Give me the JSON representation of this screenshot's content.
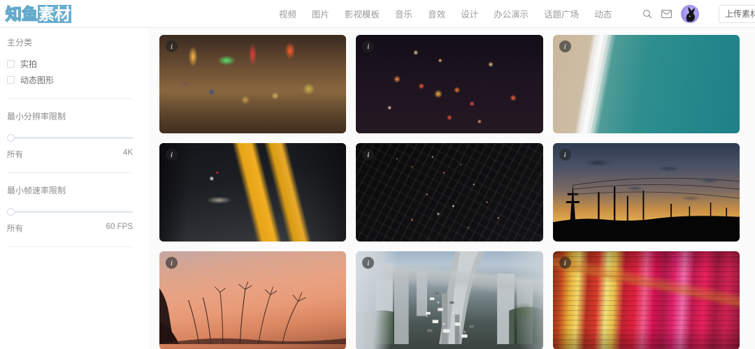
{
  "header": {
    "logo": {
      "outline_text": "知鱼",
      "solid_text": "素材"
    },
    "nav": [
      {
        "label": "视频"
      },
      {
        "label": "图片"
      },
      {
        "label": "影视模板"
      },
      {
        "label": "音乐"
      },
      {
        "label": "音效"
      },
      {
        "label": "设计"
      },
      {
        "label": "办公演示"
      },
      {
        "label": "话题广场"
      },
      {
        "label": "动态"
      }
    ],
    "icons": {
      "search": "search-icon",
      "mail": "mail-icon",
      "avatar": "avatar-rabbit-icon"
    },
    "upload_label": "上传素材",
    "accent_color": "#6aaed0"
  },
  "sidebar": {
    "category": {
      "title": "主分类",
      "options": [
        {
          "label": "实拍",
          "checked": false
        },
        {
          "label": "动态图形",
          "checked": false
        }
      ]
    },
    "filters": [
      {
        "title": "最小分辨率限制",
        "min_label": "所有",
        "max_label": "4K",
        "value_percent": 0
      },
      {
        "title": "最小帧速率限制",
        "min_label": "所有",
        "max_label": "60 FPS",
        "value_percent": 0
      }
    ]
  },
  "grid": {
    "info_badge": "i",
    "items": [
      {
        "alt": "夜市街道",
        "art": "t-market"
      },
      {
        "alt": "夜间车流散景",
        "art": "t-bokeh"
      },
      {
        "alt": "海滩航拍",
        "art": "t-beach"
      },
      {
        "alt": "地铁站台",
        "art": "t-subway"
      },
      {
        "alt": "城市夜景航拍",
        "art": "t-aerial"
      },
      {
        "alt": "黄昏电线塔",
        "art": "t-dusk"
      },
      {
        "alt": "日落草丛剪影",
        "art": "t-grass"
      },
      {
        "alt": "城市高架车流",
        "art": "t-traffic"
      },
      {
        "alt": "霓虹灯水面倒影",
        "art": "t-neon"
      }
    ]
  }
}
